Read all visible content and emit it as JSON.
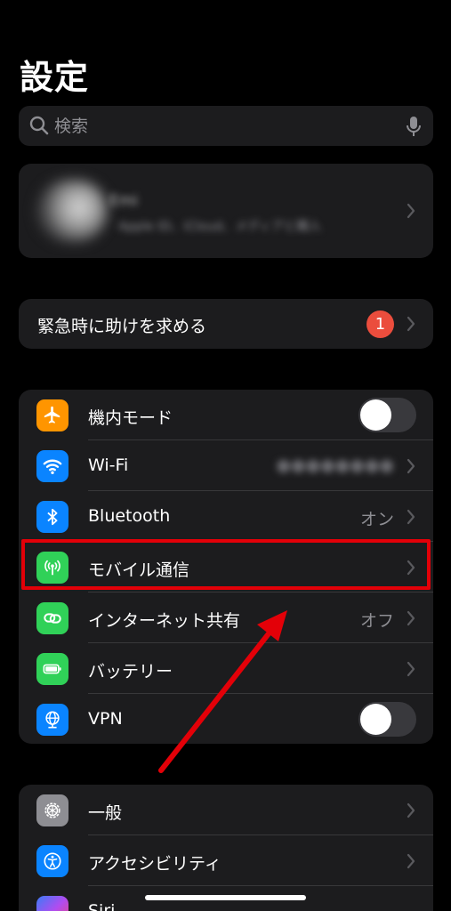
{
  "page_title": "設定",
  "search": {
    "placeholder": "検索"
  },
  "profile": {
    "name": "Emi",
    "subtitle": "Apple ID、iCloud、メディアと購入"
  },
  "emergency": {
    "label": "緊急時に助けを求める",
    "badge": "1"
  },
  "connectivity": [
    {
      "label": "機内モード",
      "value": "",
      "control": "toggle",
      "toggle_on": false,
      "icon": "airplane-icon",
      "color": "#ff9500"
    },
    {
      "label": "Wi-Fi",
      "value": "●●●●●●●●",
      "control": "chevron",
      "icon": "wifi-icon",
      "color": "#0a84ff"
    },
    {
      "label": "Bluetooth",
      "value": "オン",
      "control": "chevron",
      "icon": "bluetooth-icon",
      "color": "#0a84ff"
    },
    {
      "label": "モバイル通信",
      "value": "",
      "control": "chevron",
      "icon": "antenna-icon",
      "color": "#30d158"
    },
    {
      "label": "インターネット共有",
      "value": "オフ",
      "control": "chevron",
      "icon": "link-icon",
      "color": "#30d158"
    },
    {
      "label": "バッテリー",
      "value": "",
      "control": "chevron",
      "icon": "battery-icon",
      "color": "#30d158"
    },
    {
      "label": "VPN",
      "value": "",
      "control": "toggle",
      "toggle_on": false,
      "icon": "globe-icon",
      "color": "#0a84ff"
    }
  ],
  "general": [
    {
      "label": "一般",
      "icon": "gear-icon",
      "color": "#8e8e93"
    },
    {
      "label": "アクセシビリティ",
      "icon": "accessibility-icon",
      "color": "#0a84ff"
    },
    {
      "label": "Siri",
      "icon": "siri-icon",
      "color": "#5e5ce6"
    }
  ],
  "annotation": {
    "color": "#e30008"
  }
}
